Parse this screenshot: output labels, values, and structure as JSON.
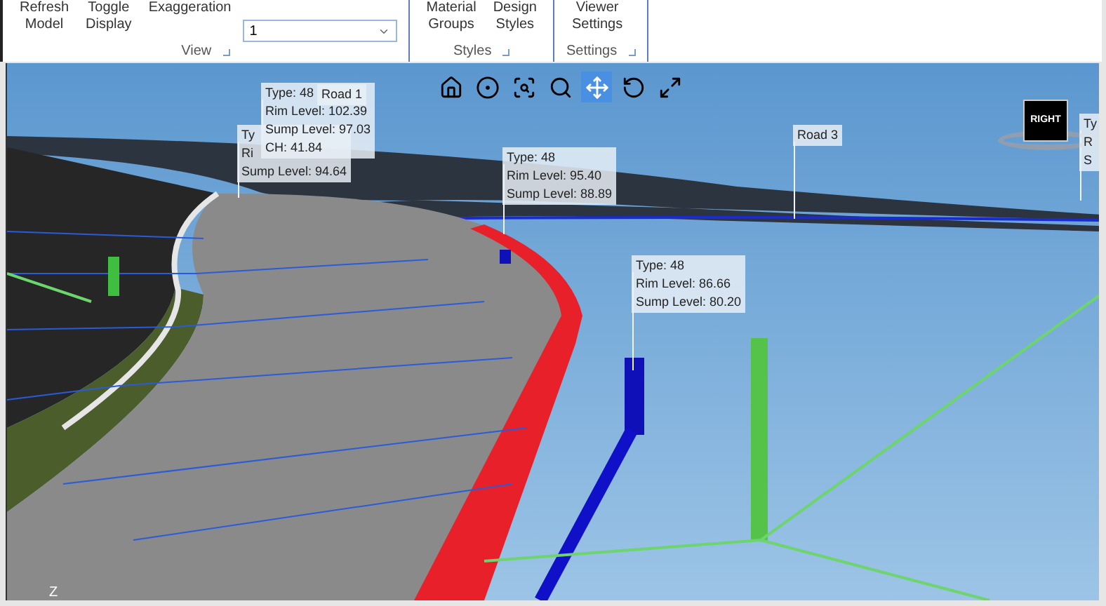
{
  "ribbon": {
    "groups": [
      {
        "label": "View",
        "items": [
          {
            "kind": "button",
            "lines": [
              "Refresh",
              "Model"
            ]
          },
          {
            "kind": "button",
            "lines": [
              "Toggle",
              "Display"
            ]
          },
          {
            "kind": "button",
            "lines": [
              "Exaggeration"
            ]
          },
          {
            "kind": "dropdown",
            "value": "1"
          }
        ]
      },
      {
        "label": "Styles",
        "items": [
          {
            "kind": "button",
            "lines": [
              "Material",
              "Groups"
            ]
          },
          {
            "kind": "button",
            "lines": [
              "Design",
              "Styles"
            ]
          }
        ]
      },
      {
        "label": "Settings",
        "items": [
          {
            "kind": "button",
            "lines": [
              "Viewer",
              "Settings"
            ]
          }
        ]
      }
    ]
  },
  "viewer": {
    "toolbar": [
      {
        "kind": "home",
        "selected": false
      },
      {
        "kind": "look",
        "selected": false
      },
      {
        "kind": "zoom-window",
        "selected": false
      },
      {
        "kind": "zoom",
        "selected": false
      },
      {
        "kind": "pan",
        "selected": true
      },
      {
        "kind": "rotate",
        "selected": false
      },
      {
        "kind": "fit",
        "selected": false
      }
    ],
    "nav_cube": {
      "face": "RIGHT"
    },
    "labels": [
      {
        "lines": [
          "Ty",
          "Ri",
          "Sump Level: 94.64"
        ]
      },
      {
        "lines": [
          "Type: 48",
          "Rim Level: 102.39",
          "Sump Level: 97.03",
          "CH: 41.84"
        ]
      },
      {
        "lines": [
          "Road 1"
        ]
      },
      {
        "lines": [
          "Type: 48",
          "Rim Level: 95.40",
          "Sump Level: 88.89"
        ]
      },
      {
        "lines": [
          "Road 3"
        ]
      },
      {
        "lines": [
          "Type: 48",
          "Rim Level: 86.66",
          "Sump Level: 80.20"
        ]
      },
      {
        "lines": [
          "Ty",
          "R",
          "S"
        ]
      }
    ],
    "axis_label": "Z"
  }
}
